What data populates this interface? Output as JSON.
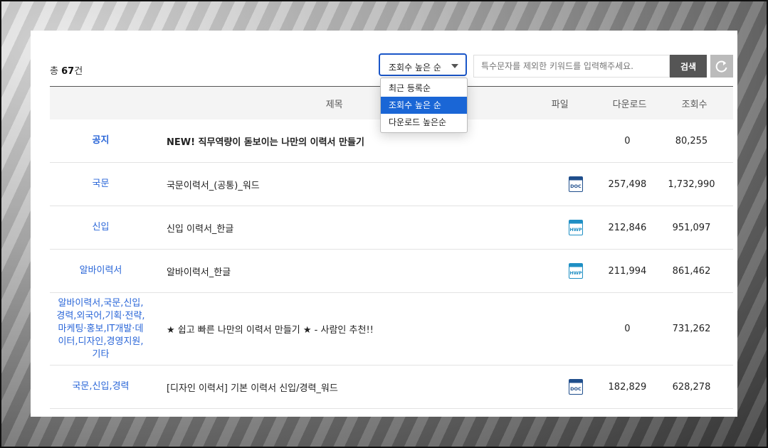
{
  "summary": {
    "prefix": "총 ",
    "count": "67",
    "suffix": "건"
  },
  "sort": {
    "selected": "조회수 높은 순",
    "options": [
      "최근 등록순",
      "조회수 높은 순",
      "다운로드 높은순"
    ]
  },
  "search": {
    "placeholder": "특수문자를 제외한 키워드를 입력해주세요.",
    "button": "검색"
  },
  "icons": {
    "reset": "refresh-icon",
    "doc": "doc-file-icon",
    "hwp": "hwp-file-icon"
  },
  "colors": {
    "accent": "#1a66d6",
    "category": "#2a66d8",
    "doc_icon": "#1f4e8c",
    "hwp_icon": "#1f8fc4"
  },
  "table": {
    "headers": {
      "title": "제목",
      "file": "파일",
      "downloads": "다운로드",
      "views": "조회수"
    },
    "rows": [
      {
        "category": "공지",
        "title": "NEW! 직무역량이 돋보이는 나만의 이력서 만들기",
        "file": "",
        "downloads": "0",
        "views": "80,255"
      },
      {
        "category": "국문",
        "title": "국문이력서_(공통)_워드",
        "file": "DOC",
        "downloads": "257,498",
        "views": "1,732,990"
      },
      {
        "category": "신입",
        "title": "신입 이력서_한글",
        "file": "HWP",
        "downloads": "212,846",
        "views": "951,097"
      },
      {
        "category": "알바이력서",
        "title": "알바이력서_한글",
        "file": "HWP",
        "downloads": "211,994",
        "views": "861,462"
      },
      {
        "category": "알바이력서,국문,신입,경력,외국어,기획·전략,마케팅·홍보,IT개발·데이터,디자인,경영지원,기타",
        "title": "★ 쉽고 빠른 나만의 이력서 만들기 ★ - 사람인 추천!!",
        "file": "",
        "downloads": "0",
        "views": "731,262"
      },
      {
        "category": "국문,신입,경력",
        "title": "[디자인 이력서] 기본 이력서 신입/경력_워드",
        "file": "DOC",
        "downloads": "182,829",
        "views": "628,278"
      }
    ]
  }
}
